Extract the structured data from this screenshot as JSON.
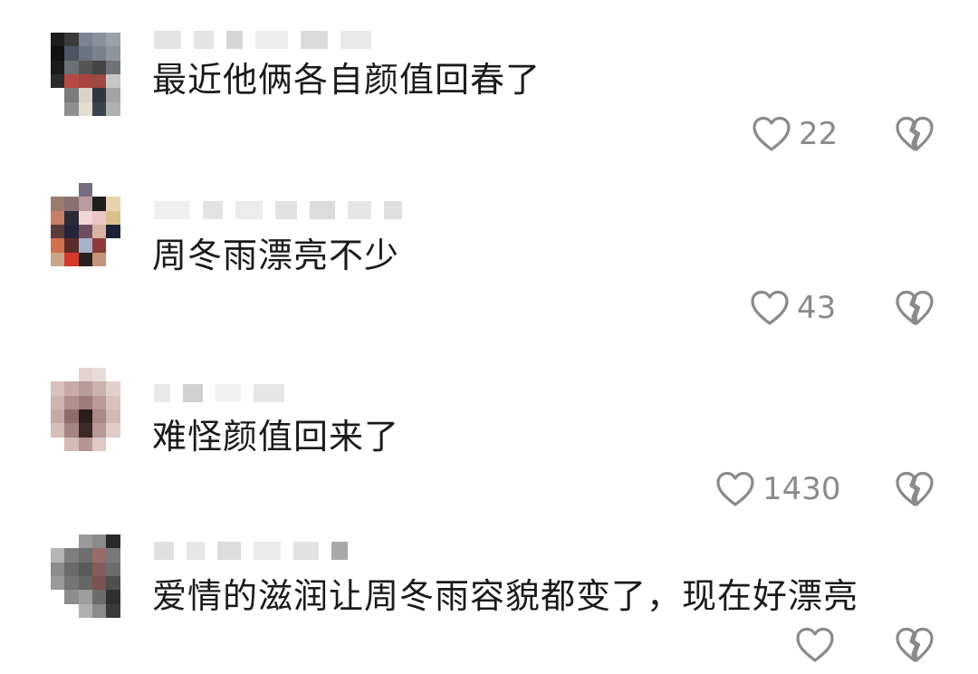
{
  "colors": {
    "text": "#1a1a1a",
    "meta": "#8a8a8a",
    "background": "#ffffff"
  },
  "icons": {
    "like": "heart-outline-icon",
    "dislike": "broken-heart-icon"
  },
  "comments": [
    {
      "text": "最近他俩各自颜值回春了",
      "likes": "22"
    },
    {
      "text": "周冬雨漂亮不少",
      "likes": "43"
    },
    {
      "text": "难怪颜值回来了",
      "likes": "1430"
    },
    {
      "text": "爱情的滋润让周冬雨容貌都变了，现在好漂亮",
      "likes": ""
    }
  ]
}
